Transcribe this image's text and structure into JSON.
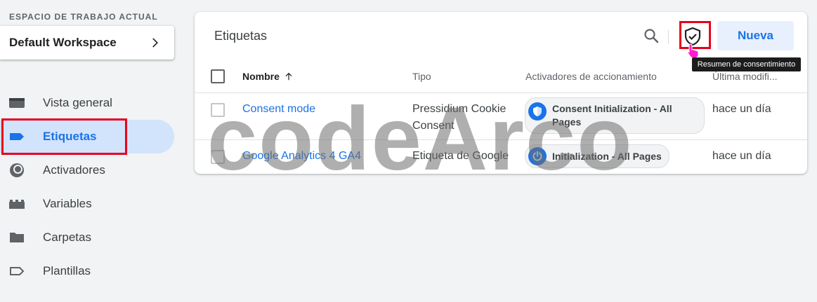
{
  "sidebar": {
    "workspace_label": "ESPACIO DE TRABAJO ACTUAL",
    "workspace_name": "Default Workspace",
    "items": [
      {
        "label": "Vista general",
        "icon": "overview-icon"
      },
      {
        "label": "Etiquetas",
        "icon": "tag-icon",
        "active": true
      },
      {
        "label": "Activadores",
        "icon": "trigger-icon"
      },
      {
        "label": "Variables",
        "icon": "variables-icon"
      },
      {
        "label": "Carpetas",
        "icon": "folder-icon"
      },
      {
        "label": "Plantillas",
        "icon": "template-icon"
      }
    ]
  },
  "main": {
    "title": "Etiquetas",
    "new_button": "Nueva",
    "tooltip": "Resumen de consentimiento",
    "columns": [
      "Nombre",
      "Tipo",
      "Activadores de accionamiento",
      "Última modifi..."
    ],
    "rows": [
      {
        "name": "Consent mode",
        "type": "Pressidium Cookie Consent",
        "trigger": "Consent Initialization - All Pages",
        "modified": "hace un día"
      },
      {
        "name": "Google Analytics 4 GA4",
        "type": "Etiqueta de Google",
        "trigger": "Initialization - All Pages",
        "modified": "hace un día"
      }
    ]
  },
  "watermark": "codeArco",
  "colors": {
    "accent": "#1a73e8",
    "highlight": "#e8001c",
    "active_bg": "#d2e3fc"
  }
}
